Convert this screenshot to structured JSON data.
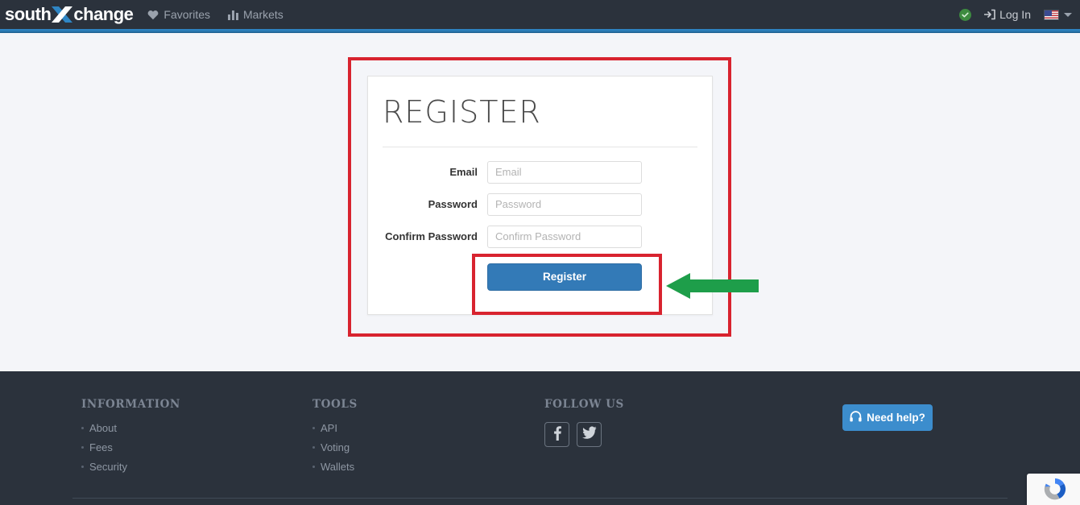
{
  "header": {
    "brand": {
      "text_left": "south",
      "text_right": "change",
      "mark": "x-logo-icon"
    },
    "nav": [
      {
        "label": "Favorites",
        "icon": "heart-icon"
      },
      {
        "label": "Markets",
        "icon": "bar-chart-icon"
      }
    ],
    "status": {
      "icon": "check-circle-icon",
      "color": "#3d8b40"
    },
    "login": {
      "label": "Log In",
      "icon": "sign-in-icon"
    },
    "language": {
      "flag": "us-flag-icon",
      "caret": "caret-down-icon"
    },
    "accent_color": "#2f86c5",
    "background_color": "#2b323c"
  },
  "register": {
    "title": "REGISTER",
    "fields": [
      {
        "label": "Email",
        "placeholder": "Email",
        "value": "",
        "type": "email"
      },
      {
        "label": "Password",
        "placeholder": "Password",
        "value": "",
        "type": "password"
      },
      {
        "label": "Confirm Password",
        "placeholder": "Confirm Password",
        "value": "",
        "type": "password"
      }
    ],
    "submit_label": "Register",
    "submit_color": "#337ab7"
  },
  "annotations": {
    "outer_box_color": "#d8232f",
    "inner_box_color": "#d8232f",
    "arrow_color": "#1e9e4a",
    "arrow_direction": "left"
  },
  "footer": {
    "columns": [
      {
        "heading": "INFORMATION",
        "links": [
          {
            "label": "About"
          },
          {
            "label": "Fees"
          },
          {
            "label": "Security"
          }
        ]
      },
      {
        "heading": "TOOLS",
        "links": [
          {
            "label": "API"
          },
          {
            "label": "Voting"
          },
          {
            "label": "Wallets"
          }
        ]
      }
    ],
    "follow": {
      "heading": "FOLLOW US",
      "socials": [
        {
          "name": "facebook-icon"
        },
        {
          "name": "twitter-icon"
        }
      ]
    },
    "help_button": {
      "label": "Need help?",
      "icon": "headphones-icon",
      "color": "#3c8dcd"
    },
    "background_color": "#2b323c"
  },
  "recaptcha": {
    "icon": "recaptcha-icon"
  },
  "page": {
    "background_color": "#f4f5f9"
  }
}
